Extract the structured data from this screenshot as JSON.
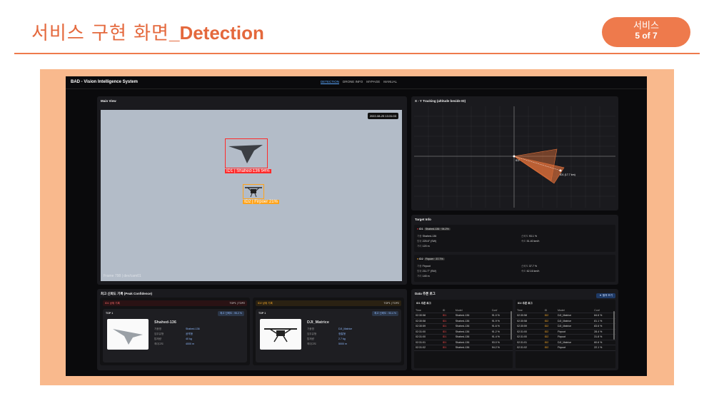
{
  "slide": {
    "title_prefix": "서비스 구현 화면",
    "title_suffix": "_Detection",
    "badge_top": "서비스",
    "badge_bottom": "5 of 7"
  },
  "app": {
    "title": "BAD - Vision Intelligence System",
    "nav": [
      "DETECTION",
      "DRONE INFO",
      "MYPAGE",
      "MANUAL"
    ],
    "active_nav": "DETECTION"
  },
  "main_view": {
    "title": "Main View",
    "timestamp": "2022-08-25 13:31:03",
    "watermark": "Frame 798 | dev/cam01",
    "detections": [
      {
        "label": "ID1 | Shahed-136 94%",
        "color": "#ff2a2a"
      },
      {
        "label": "ID2 | Firpoer 21%",
        "color": "#ffa31a"
      }
    ]
  },
  "tracking": {
    "title": "X - Y Tracking (altitude beside ID)",
    "labels": [
      "ID2",
      "ID1 (17.7 km)"
    ],
    "colors": {
      "sector": "#e0703a",
      "grid": "#3a3a3f"
    }
  },
  "target_info": {
    "title": "Target Info",
    "targets": [
      {
        "id": "ID1",
        "header": "Shahed-136 · 94.2%",
        "dot_color": "#ff3b3b",
        "rows": [
          [
            "기종",
            "Shahed-136"
          ],
          [
            "방위",
            "225.6° (SW)"
          ],
          [
            "거리",
            "120 m"
          ]
        ],
        "right_rows": [
          [
            "신뢰도",
            "93.1 %"
          ],
          [
            "속도",
            "51.40 km/h"
          ]
        ]
      },
      {
        "id": "ID2",
        "header": "Firpoer · 37.7%",
        "dot_color": "#ffae2b",
        "rows": [
          [
            "기종",
            "Firpoot"
          ],
          [
            "방위",
            "211.7° (SW)"
          ],
          [
            "거리",
            "145 m"
          ]
        ],
        "right_rows": [
          [
            "신뢰도",
            "37.7 %"
          ],
          [
            "속도",
            "62.16 km/h"
          ]
        ]
      }
    ]
  },
  "peak": {
    "title": "최고 신뢰도 기록 (Peak Confidence)",
    "cards": [
      {
        "header_left": "ID1 상위 기록",
        "header_right": "TOP1 | TOP2",
        "top_label": "TOP 1",
        "pill": "최고 신뢰도 : 95.2 %",
        "name": "Shahed-136",
        "rows": [
          [
            "기종명",
            "Shahed-136"
          ],
          [
            "임무유형",
            "공격형"
          ],
          [
            "탑재량",
            "40 kg"
          ],
          [
            "최대고도",
            "4000 m"
          ]
        ]
      },
      {
        "header_left": "ID2 상위 기록",
        "header_right": "TOP1 | TOP2",
        "top_label": "TOP 1",
        "pill": "최고 신뢰도 : 93.4 %",
        "name": "DJI_Matrice",
        "rows": [
          [
            "기종명",
            "DJI_Matrice"
          ],
          [
            "임무유형",
            "정찰형"
          ],
          [
            "탑재량",
            "2.7 kg"
          ],
          [
            "최대고도",
            "5000 m"
          ]
        ]
      }
    ]
  },
  "logs": {
    "title": "Data 추론 로그",
    "button": "▼ 펼쳐 보기",
    "columns": [
      "Time",
      "ID",
      "Model",
      "Conf"
    ],
    "id1": {
      "title": "ID1 추론 로그",
      "rows": [
        [
          "02:30:58",
          "ID1",
          "Shahed-136",
          "91.0 %"
        ],
        [
          "02:30:58",
          "ID1",
          "Shahed-136",
          "91.9 %"
        ],
        [
          "02:30:59",
          "ID1",
          "Shahed-136",
          "91.6 %"
        ],
        [
          "02:31:00",
          "ID1",
          "Shahed-136",
          "91.2 %"
        ],
        [
          "02:31:00",
          "ID1",
          "Shahed-136",
          "91.4 %"
        ],
        [
          "02:31:01",
          "ID1",
          "Shahed-136",
          "93.0 %"
        ],
        [
          "02:31:02",
          "ID1",
          "Shahed-136",
          "94.2 %"
        ]
      ]
    },
    "id2": {
      "title": "ID2 추론 로그",
      "rows": [
        [
          "02:30:58",
          "ID2",
          "DJI_Matrice",
          "84.6 %"
        ],
        [
          "02:30:58",
          "ID2",
          "DJI_Matrice",
          "81.1 %"
        ],
        [
          "02:30:59",
          "ID2",
          "DJI_Matrice",
          "83.6 %"
        ],
        [
          "02:31:00",
          "ID2",
          "Firpoot",
          "28.4 %"
        ],
        [
          "02:31:00",
          "ID2",
          "Firpoot",
          "31.8 %"
        ],
        [
          "02:31:01",
          "ID2",
          "DJI_Matrice",
          "60.6 %"
        ],
        [
          "02:31:02",
          "ID2",
          "Firpoot",
          "22.1 %"
        ]
      ]
    }
  }
}
